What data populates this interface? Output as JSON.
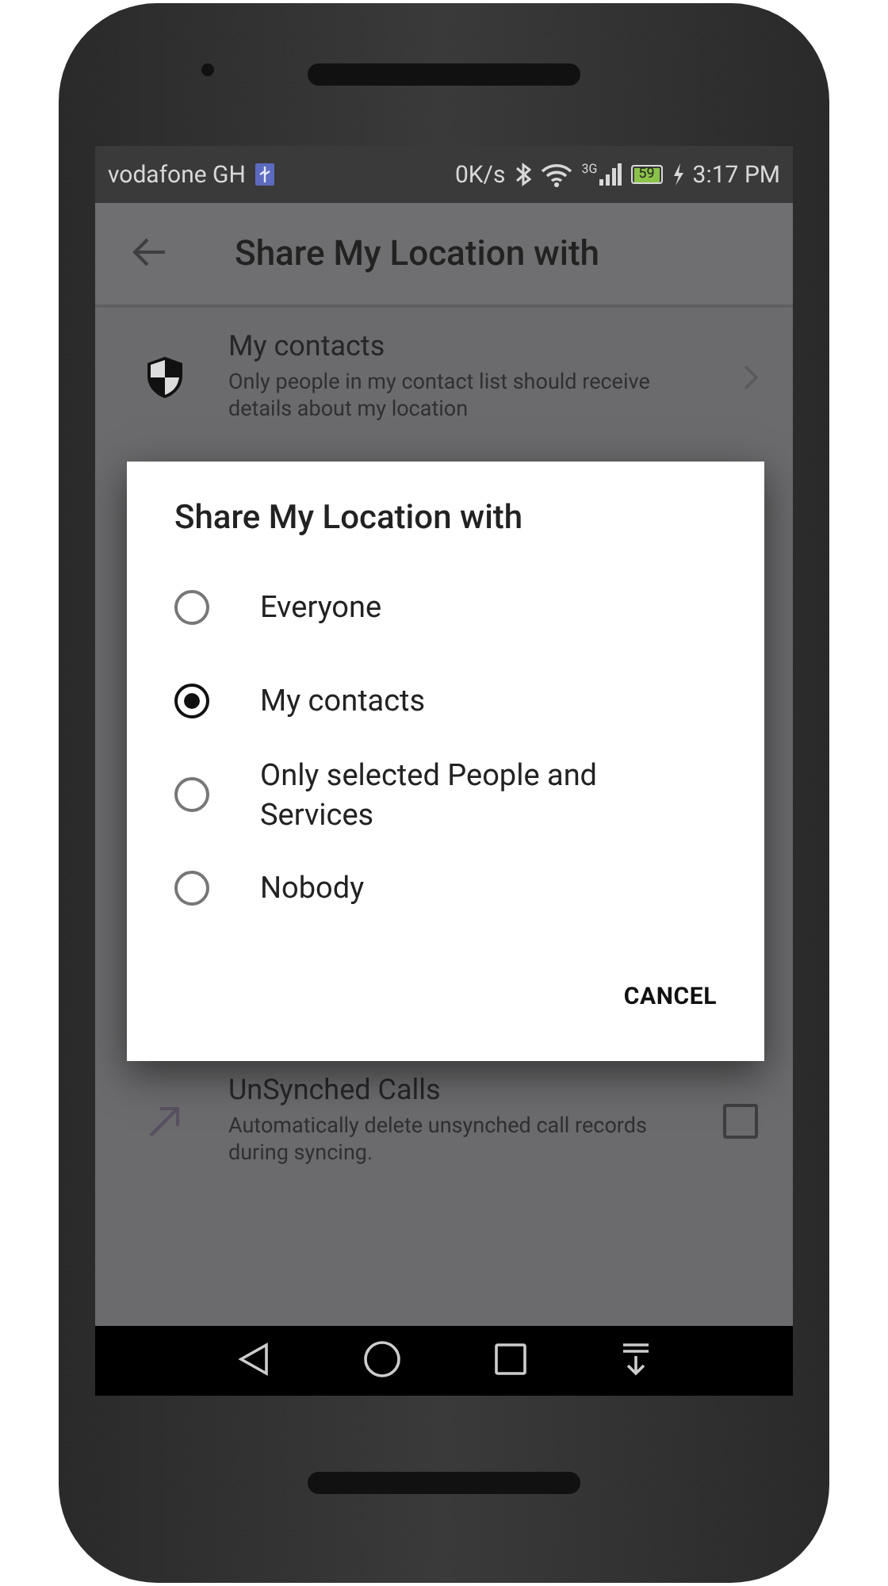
{
  "status_bar": {
    "carrier": "vodafone GH",
    "speed": "0K/s",
    "network": "3G",
    "battery": "59",
    "time": "3:17 PM"
  },
  "app_bar": {
    "title": "Share My Location with"
  },
  "settings": [
    {
      "kind": "link",
      "title": "My contacts",
      "subtitle": "Only people in my contact list should receive details about my location"
    },
    {
      "kind": "checkbox",
      "title": "UnSynched Calls",
      "subtitle": "Automatically delete unsynched call records during syncing.",
      "checked": false
    }
  ],
  "dialog": {
    "title": "Share My Location with",
    "options": [
      {
        "label": "Everyone",
        "selected": false
      },
      {
        "label": "My contacts",
        "selected": true
      },
      {
        "label": "Only selected People and Services",
        "selected": false
      },
      {
        "label": "Nobody",
        "selected": false
      }
    ],
    "buttons": [
      "CANCEL"
    ]
  }
}
